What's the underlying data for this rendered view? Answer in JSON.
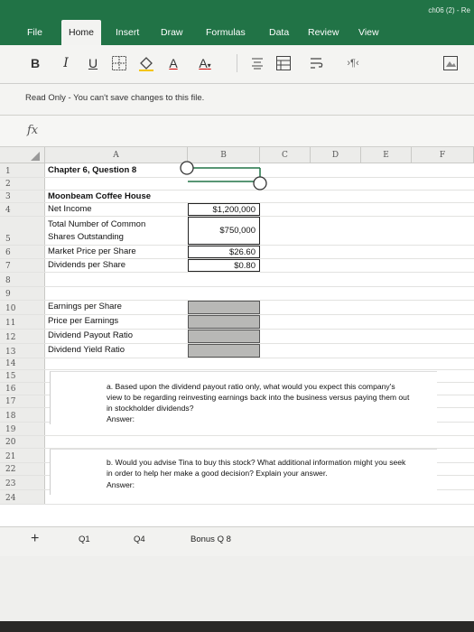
{
  "window": {
    "title": "ch06 (2) - Re"
  },
  "ribbon": {
    "tabs": [
      {
        "label": "File"
      },
      {
        "label": "Home",
        "active": true
      },
      {
        "label": "Insert"
      },
      {
        "label": "Draw"
      },
      {
        "label": "Formulas"
      },
      {
        "label": "Data"
      },
      {
        "label": "Review"
      },
      {
        "label": "View"
      }
    ],
    "tools": {
      "bold": "B",
      "italic": "I",
      "underline": "U",
      "font_color": "A",
      "font_size_up": "A"
    },
    "accent_color": "#217346"
  },
  "readonly_message": "Read Only - You can't save changes to this file.",
  "formula_bar": {
    "fx_label": "fx",
    "value": ""
  },
  "columns": [
    "A",
    "B",
    "C",
    "D",
    "E",
    "F"
  ],
  "rows": [
    {
      "num": "1",
      "a": "Chapter 6, Question 8",
      "b": "",
      "a_bold": true
    },
    {
      "num": "2",
      "a": "",
      "b": ""
    },
    {
      "num": "3",
      "a": "Moonbeam Coffee House",
      "b": "",
      "a_bold": true
    },
    {
      "num": "4",
      "a": "Net Income",
      "b": "$1,200,000",
      "boxed": true
    },
    {
      "num": "5",
      "a": "Total Number of Common",
      "a2": "Shares Outstanding",
      "b": "$750,000",
      "boxed": true
    },
    {
      "num": "6",
      "a": "Market Price per Share",
      "b": "$26.60",
      "boxed": true
    },
    {
      "num": "7",
      "a": "Dividends per Share",
      "b": "$0.80",
      "boxed": true
    },
    {
      "num": "8",
      "a": "",
      "b": ""
    },
    {
      "num": "9",
      "a": "",
      "b": ""
    },
    {
      "num": "10",
      "a": "Earnings per Share",
      "b": "",
      "shaded": true
    },
    {
      "num": "11",
      "a": "Price per Earnings",
      "b": "",
      "shaded": true
    },
    {
      "num": "12",
      "a": "Dividend Payout Ratio",
      "b": "",
      "shaded": true
    },
    {
      "num": "13",
      "a": "Dividend Yield Ratio",
      "b": "",
      "shaded": true
    },
    {
      "num": "14",
      "a": "",
      "b": ""
    },
    {
      "num": "15",
      "a": "",
      "b": ""
    },
    {
      "num": "16",
      "a": "",
      "b": ""
    },
    {
      "num": "17",
      "a": "",
      "b": ""
    },
    {
      "num": "18",
      "a": "",
      "b": ""
    },
    {
      "num": "19",
      "a": "",
      "b": ""
    },
    {
      "num": "20",
      "a": "",
      "b": ""
    },
    {
      "num": "21",
      "a": "",
      "b": ""
    },
    {
      "num": "22",
      "a": "",
      "b": ""
    },
    {
      "num": "23",
      "a": "",
      "b": ""
    },
    {
      "num": "24",
      "a": "",
      "b": ""
    }
  ],
  "question_a": {
    "line1": "a. Based upon the dividend payout ratio only, what would you expect this company's",
    "line2": "view to be regarding reinvesting earnings back into the business versus paying them out",
    "line3": "in stockholder dividends?",
    "answer_label": "Answer:"
  },
  "question_b": {
    "line1": "b. Would you advise Tina to buy this stock? What additional information might you seek",
    "line2": "in order to help her make a good decision? Explain your answer.",
    "answer_label": "Answer:"
  },
  "sheet_tabs": [
    {
      "label": "Q1"
    },
    {
      "label": "Q4"
    },
    {
      "label": "Bonus Q 8"
    }
  ],
  "add_sheet": "+"
}
